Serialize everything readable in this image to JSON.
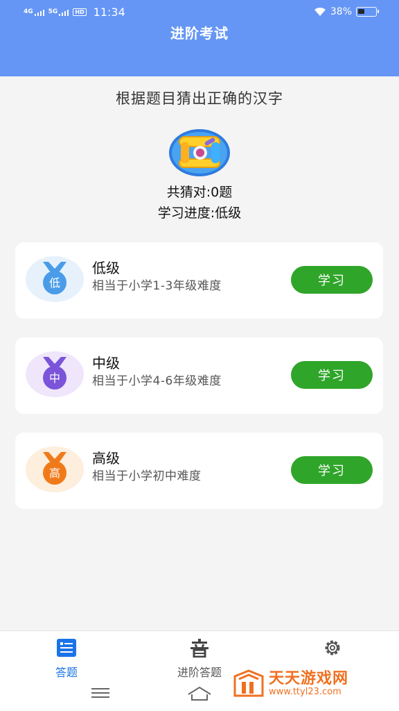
{
  "status_bar": {
    "signal1": "4G",
    "signal2": "5G",
    "hd": "HD",
    "time": "11:34",
    "battery": "38%",
    "battery_level": 0.38
  },
  "header": {
    "title": "进阶考试"
  },
  "intro": {
    "subtitle": "根据题目猜出正确的汉字",
    "correct_count": "共猜对:0题",
    "progress": "学习进度:低级"
  },
  "levels": [
    {
      "name": "低级",
      "desc": "相当于小学1-3年级难度",
      "badge": "低",
      "color": "#4a9ce8",
      "bg": "#e6f1fc",
      "button": "学习"
    },
    {
      "name": "中级",
      "desc": "相当于小学4-6年级难度",
      "badge": "中",
      "color": "#7b54d9",
      "bg": "#efe6fb",
      "button": "学习"
    },
    {
      "name": "高级",
      "desc": "相当于小学初中难度",
      "badge": "高",
      "color": "#f07a1a",
      "bg": "#fdeedd",
      "button": "学习"
    }
  ],
  "tabs": [
    {
      "label": "答题",
      "icon": "quiz-icon",
      "active": true
    },
    {
      "label": "进阶答题",
      "icon": "sound-char-icon",
      "active": false
    },
    {
      "label": "",
      "icon": "gear-icon",
      "active": false
    }
  ],
  "watermark": {
    "name": "天天游戏网",
    "url": "www.ttyl23.com"
  },
  "colors": {
    "header": "#6596f5",
    "accent": "#1a73e8",
    "button": "#2fa52a"
  }
}
